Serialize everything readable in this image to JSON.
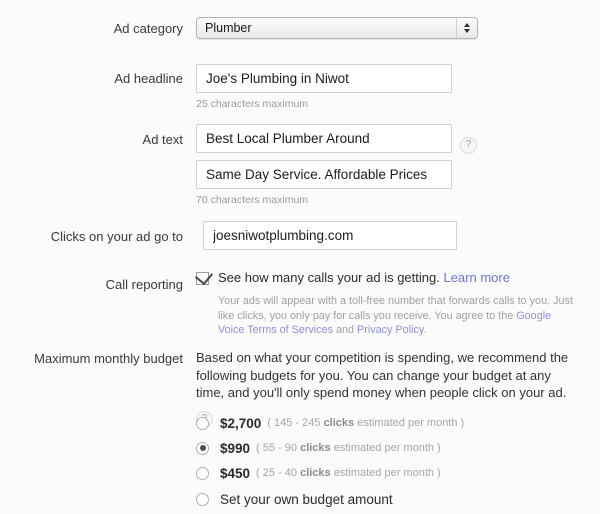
{
  "fields": {
    "ad_category": {
      "label": "Ad category",
      "value": "Plumber"
    },
    "ad_headline": {
      "label": "Ad headline",
      "value": "Joe's Plumbing in Niwot",
      "hint": "25 characters maximum"
    },
    "ad_text": {
      "label": "Ad text",
      "line1": "Best Local Plumber Around",
      "line2": "Same Day Service. Affordable Prices",
      "hint": "70 characters maximum",
      "help": "?"
    },
    "destination": {
      "label": "Clicks on your ad go to",
      "value": "joesniwotplumbing.com"
    },
    "call_reporting": {
      "label": "Call reporting",
      "checkbox_label": "See how many calls your ad is getting.",
      "learn_more": "Learn more",
      "checked": true,
      "disclaimer_part1": "Your ads will appear with a toll-free number that forwards calls to you. Just like clicks, you only pay for calls you receive. You agree to the ",
      "disclaimer_link1": "Google Voice Terms of Services",
      "disclaimer_part2": " and ",
      "disclaimer_link2": "Privacy Policy",
      "disclaimer_part3": "."
    },
    "budget": {
      "label": "Maximum monthly budget",
      "description": "Based on what your competition is spending, we recommend the following budgets for you. You can change your budget at any time, and you'll only spend money when people click on your ad.",
      "help": "?",
      "options": [
        {
          "amount": "$2,700",
          "estimate_prefix": "( 145 - 245 ",
          "estimate_bold": "clicks",
          "estimate_suffix": " estimated per month )",
          "selected": false
        },
        {
          "amount": "$990",
          "estimate_prefix": "( 55 - 90 ",
          "estimate_bold": "clicks",
          "estimate_suffix": " estimated per month )",
          "selected": true
        },
        {
          "amount": "$450",
          "estimate_prefix": "( 25 - 40 ",
          "estimate_bold": "clicks",
          "estimate_suffix": " estimated per month )",
          "selected": false
        }
      ],
      "custom_option": "Set your own budget amount"
    }
  },
  "colors": {
    "link": "#7272d4",
    "text": "#333333",
    "hint": "#9a9a9a",
    "background": "#fbfbfb"
  }
}
